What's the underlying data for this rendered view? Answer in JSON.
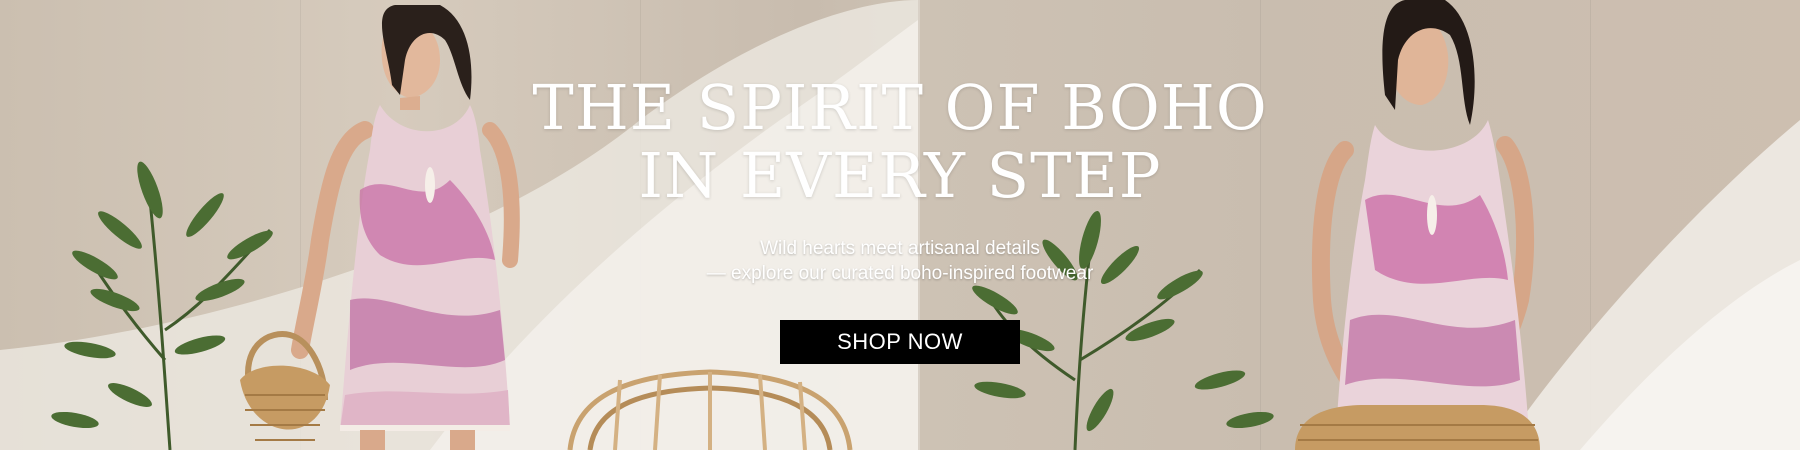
{
  "banner": {
    "headline_line1": "THE SPIRIT OF BOHO",
    "headline_line2": "IN EVERY STEP",
    "subtext_line1": "Wild hearts meet artisanal details",
    "subtext_line2": "— explore our curated boho-inspired footwear",
    "cta_label": "SHOP NOW"
  },
  "colors": {
    "text": "#ffffff",
    "cta_background": "#000000",
    "cta_text": "#ffffff"
  }
}
